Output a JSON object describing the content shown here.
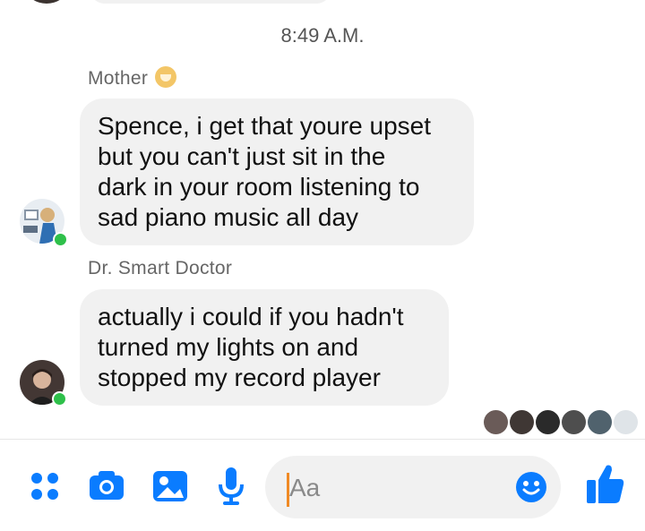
{
  "conversation": {
    "timestamp": "8:49 A.M.",
    "messages": [
      {
        "sender": "Mother",
        "text": "Spence, i get that youre upset\nbut you can't just sit in the\ndark in your room listening to\nsad piano music all day"
      },
      {
        "sender": "Dr. Smart Doctor",
        "text": "actually i could if you hadn't\nturned my lights on and\nstopped my record player"
      }
    ]
  },
  "composer": {
    "placeholder": "Aa"
  },
  "colors": {
    "accent": "#0a7cff",
    "online": "#2ec04a",
    "bubble": "#f1f1f1"
  },
  "icons": [
    "menu-dots-icon",
    "camera-icon",
    "image-icon",
    "microphone-icon",
    "emoji-icon",
    "thumbs-up-icon"
  ]
}
